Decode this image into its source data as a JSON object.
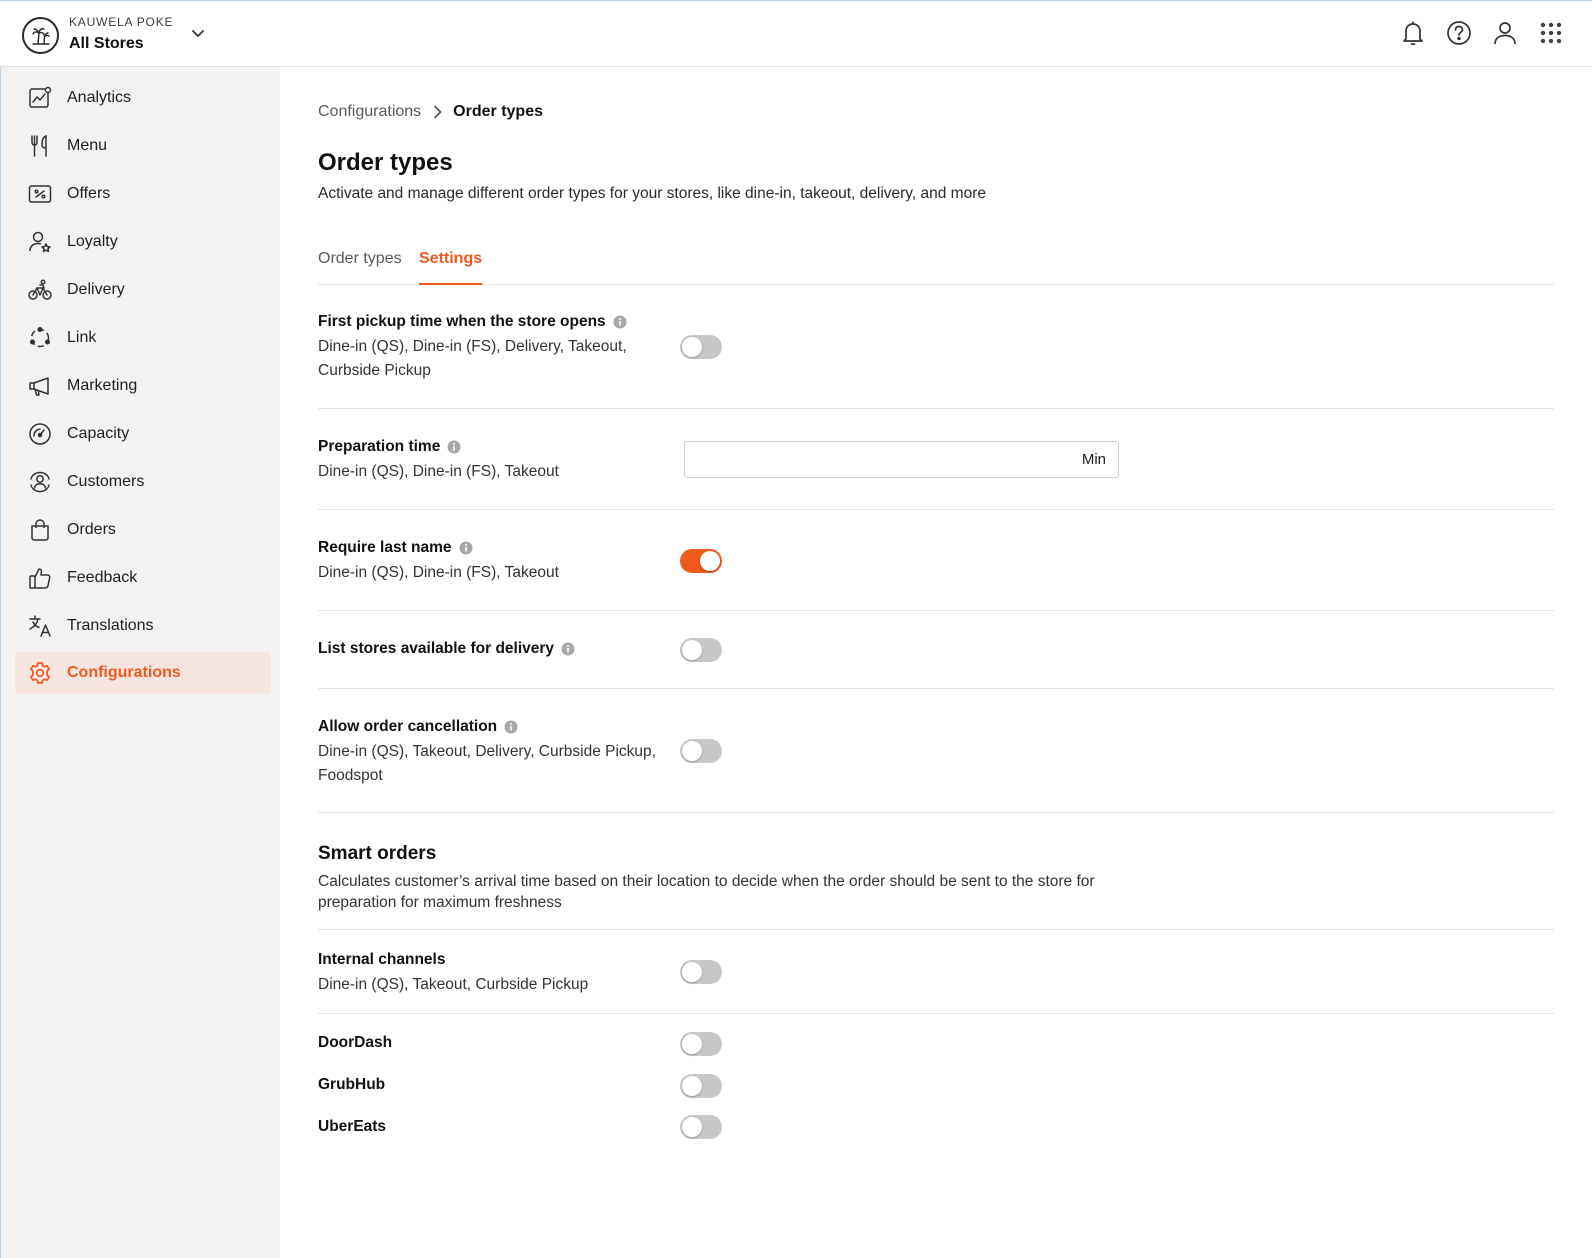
{
  "header": {
    "brand_name": "KAUWELA POKE",
    "store_selector": "All Stores",
    "icons": [
      "bell-icon",
      "help-icon",
      "user-icon",
      "apps-grid-icon"
    ]
  },
  "sidebar": {
    "items": [
      {
        "label": "Analytics",
        "icon": "analytics-icon"
      },
      {
        "label": "Menu",
        "icon": "utensils-icon"
      },
      {
        "label": "Offers",
        "icon": "offers-icon"
      },
      {
        "label": "Loyalty",
        "icon": "loyalty-icon"
      },
      {
        "label": "Delivery",
        "icon": "bike-icon"
      },
      {
        "label": "Link",
        "icon": "link-icon"
      },
      {
        "label": "Marketing",
        "icon": "megaphone-icon"
      },
      {
        "label": "Capacity",
        "icon": "gauge-icon"
      },
      {
        "label": "Customers",
        "icon": "customers-icon"
      },
      {
        "label": "Orders",
        "icon": "bag-icon"
      },
      {
        "label": "Feedback",
        "icon": "thumbs-up-icon"
      },
      {
        "label": "Translations",
        "icon": "translate-icon"
      },
      {
        "label": "Configurations",
        "icon": "gear-icon",
        "active": true
      }
    ]
  },
  "breadcrumb": {
    "parent": "Configurations",
    "current": "Order types"
  },
  "page": {
    "title": "Order types",
    "description": "Activate and manage different order types for your stores, like dine-in, takeout, delivery, and more"
  },
  "tabs": [
    {
      "label": "Order types",
      "active": false
    },
    {
      "label": "Settings",
      "active": true
    }
  ],
  "settings": {
    "first_pickup": {
      "title": "First pickup time when the store opens",
      "sub": "Dine-in (QS), Dine-in (FS), Delivery, Takeout, Curbside Pickup",
      "enabled": false
    },
    "prep_time": {
      "title": "Preparation time",
      "sub": "Dine-in (QS), Dine-in (FS), Takeout",
      "value": "",
      "unit": "Min"
    },
    "last_name": {
      "title": "Require last name",
      "sub": "Dine-in (QS), Dine-in (FS), Takeout",
      "enabled": true
    },
    "list_stores": {
      "title": "List stores available for delivery",
      "enabled": false
    },
    "cancellation": {
      "title": "Allow order cancellation",
      "sub": "Dine-in (QS), Takeout, Delivery, Curbside Pickup, Foodspot",
      "enabled": false
    }
  },
  "smart_orders": {
    "title": "Smart orders",
    "description": "Calculates customer’s arrival time based on their location to decide when the order should be sent to the store for preparation for maximum freshness",
    "internal": {
      "title": "Internal channels",
      "sub": "Dine-in (QS), Takeout, Curbside Pickup",
      "enabled": false
    },
    "doordash": {
      "title": "DoorDash",
      "enabled": false
    },
    "grubhub": {
      "title": "GrubHub",
      "enabled": false
    },
    "ubereats": {
      "title": "UberEats",
      "enabled": false
    }
  },
  "colors": {
    "accent": "#f05a1f",
    "active_nav_bg": "#f6e4df",
    "toggle_off": "#c8c8c8",
    "sidebar_bg": "#f2f2f2"
  }
}
